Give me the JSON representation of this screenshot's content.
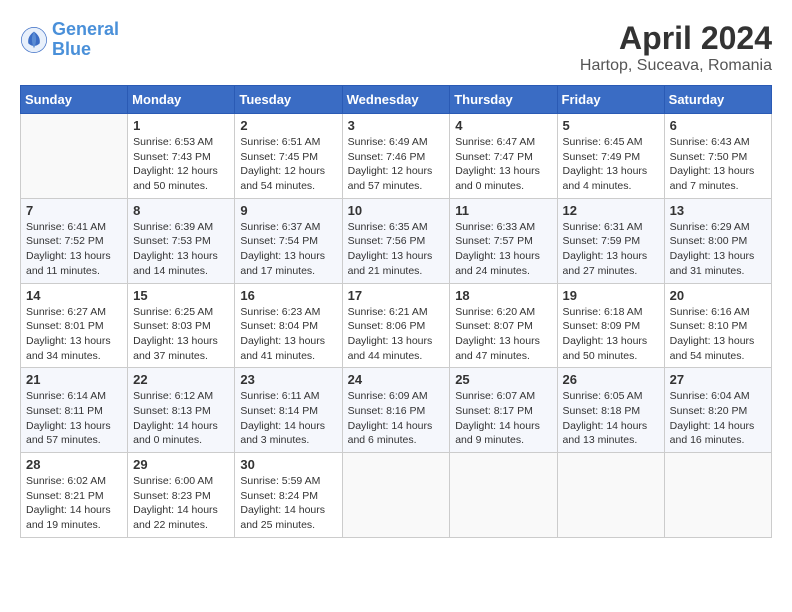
{
  "header": {
    "logo_line1": "General",
    "logo_line2": "Blue",
    "title": "April 2024",
    "subtitle": "Hartop, Suceava, Romania"
  },
  "calendar": {
    "weekdays": [
      "Sunday",
      "Monday",
      "Tuesday",
      "Wednesday",
      "Thursday",
      "Friday",
      "Saturday"
    ],
    "weeks": [
      [
        {
          "day": "",
          "info": ""
        },
        {
          "day": "1",
          "info": "Sunrise: 6:53 AM\nSunset: 7:43 PM\nDaylight: 12 hours\nand 50 minutes."
        },
        {
          "day": "2",
          "info": "Sunrise: 6:51 AM\nSunset: 7:45 PM\nDaylight: 12 hours\nand 54 minutes."
        },
        {
          "day": "3",
          "info": "Sunrise: 6:49 AM\nSunset: 7:46 PM\nDaylight: 12 hours\nand 57 minutes."
        },
        {
          "day": "4",
          "info": "Sunrise: 6:47 AM\nSunset: 7:47 PM\nDaylight: 13 hours\nand 0 minutes."
        },
        {
          "day": "5",
          "info": "Sunrise: 6:45 AM\nSunset: 7:49 PM\nDaylight: 13 hours\nand 4 minutes."
        },
        {
          "day": "6",
          "info": "Sunrise: 6:43 AM\nSunset: 7:50 PM\nDaylight: 13 hours\nand 7 minutes."
        }
      ],
      [
        {
          "day": "7",
          "info": "Sunrise: 6:41 AM\nSunset: 7:52 PM\nDaylight: 13 hours\nand 11 minutes."
        },
        {
          "day": "8",
          "info": "Sunrise: 6:39 AM\nSunset: 7:53 PM\nDaylight: 13 hours\nand 14 minutes."
        },
        {
          "day": "9",
          "info": "Sunrise: 6:37 AM\nSunset: 7:54 PM\nDaylight: 13 hours\nand 17 minutes."
        },
        {
          "day": "10",
          "info": "Sunrise: 6:35 AM\nSunset: 7:56 PM\nDaylight: 13 hours\nand 21 minutes."
        },
        {
          "day": "11",
          "info": "Sunrise: 6:33 AM\nSunset: 7:57 PM\nDaylight: 13 hours\nand 24 minutes."
        },
        {
          "day": "12",
          "info": "Sunrise: 6:31 AM\nSunset: 7:59 PM\nDaylight: 13 hours\nand 27 minutes."
        },
        {
          "day": "13",
          "info": "Sunrise: 6:29 AM\nSunset: 8:00 PM\nDaylight: 13 hours\nand 31 minutes."
        }
      ],
      [
        {
          "day": "14",
          "info": "Sunrise: 6:27 AM\nSunset: 8:01 PM\nDaylight: 13 hours\nand 34 minutes."
        },
        {
          "day": "15",
          "info": "Sunrise: 6:25 AM\nSunset: 8:03 PM\nDaylight: 13 hours\nand 37 minutes."
        },
        {
          "day": "16",
          "info": "Sunrise: 6:23 AM\nSunset: 8:04 PM\nDaylight: 13 hours\nand 41 minutes."
        },
        {
          "day": "17",
          "info": "Sunrise: 6:21 AM\nSunset: 8:06 PM\nDaylight: 13 hours\nand 44 minutes."
        },
        {
          "day": "18",
          "info": "Sunrise: 6:20 AM\nSunset: 8:07 PM\nDaylight: 13 hours\nand 47 minutes."
        },
        {
          "day": "19",
          "info": "Sunrise: 6:18 AM\nSunset: 8:09 PM\nDaylight: 13 hours\nand 50 minutes."
        },
        {
          "day": "20",
          "info": "Sunrise: 6:16 AM\nSunset: 8:10 PM\nDaylight: 13 hours\nand 54 minutes."
        }
      ],
      [
        {
          "day": "21",
          "info": "Sunrise: 6:14 AM\nSunset: 8:11 PM\nDaylight: 13 hours\nand 57 minutes."
        },
        {
          "day": "22",
          "info": "Sunrise: 6:12 AM\nSunset: 8:13 PM\nDaylight: 14 hours\nand 0 minutes."
        },
        {
          "day": "23",
          "info": "Sunrise: 6:11 AM\nSunset: 8:14 PM\nDaylight: 14 hours\nand 3 minutes."
        },
        {
          "day": "24",
          "info": "Sunrise: 6:09 AM\nSunset: 8:16 PM\nDaylight: 14 hours\nand 6 minutes."
        },
        {
          "day": "25",
          "info": "Sunrise: 6:07 AM\nSunset: 8:17 PM\nDaylight: 14 hours\nand 9 minutes."
        },
        {
          "day": "26",
          "info": "Sunrise: 6:05 AM\nSunset: 8:18 PM\nDaylight: 14 hours\nand 13 minutes."
        },
        {
          "day": "27",
          "info": "Sunrise: 6:04 AM\nSunset: 8:20 PM\nDaylight: 14 hours\nand 16 minutes."
        }
      ],
      [
        {
          "day": "28",
          "info": "Sunrise: 6:02 AM\nSunset: 8:21 PM\nDaylight: 14 hours\nand 19 minutes."
        },
        {
          "day": "29",
          "info": "Sunrise: 6:00 AM\nSunset: 8:23 PM\nDaylight: 14 hours\nand 22 minutes."
        },
        {
          "day": "30",
          "info": "Sunrise: 5:59 AM\nSunset: 8:24 PM\nDaylight: 14 hours\nand 25 minutes."
        },
        {
          "day": "",
          "info": ""
        },
        {
          "day": "",
          "info": ""
        },
        {
          "day": "",
          "info": ""
        },
        {
          "day": "",
          "info": ""
        }
      ]
    ]
  }
}
